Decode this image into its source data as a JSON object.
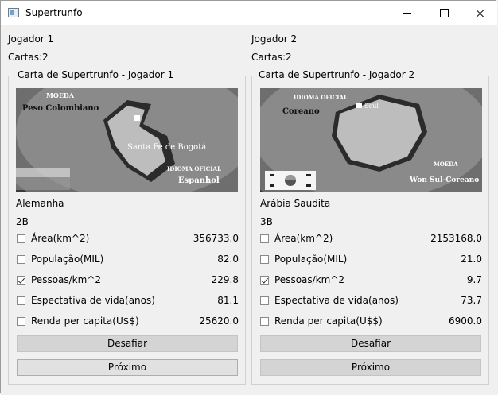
{
  "window": {
    "title": "Supertrunfo"
  },
  "players": [
    {
      "name": "Jogador 1",
      "cards_label": "Cartas:2",
      "group_title": "Carta de Supertrunfo - Jogador 1",
      "card": {
        "image_text": {
          "moeda": "MOEDA",
          "moeda_value": "Peso Colombiano",
          "capital": "Santa Fe de Bogotá",
          "idioma": "IDIOMA OFICIAL",
          "idioma_value": "Espanhol"
        },
        "country": "Alemanha",
        "code": "2B",
        "attributes": [
          {
            "label": "Área(km^2)",
            "value": "356733.0",
            "checked": false
          },
          {
            "label": "População(MIL)",
            "value": "82.0",
            "checked": false
          },
          {
            "label": "Pessoas/km^2",
            "value": "229.8",
            "checked": true
          },
          {
            "label": "Espectativa de vida(anos)",
            "value": "81.1",
            "checked": false
          },
          {
            "label": "Renda per capita(U$$)",
            "value": "25620.0",
            "checked": false
          }
        ]
      },
      "challenge_label": "Desafiar",
      "next_label": "Próximo"
    },
    {
      "name": "Jogador 2",
      "cards_label": "Cartas:2",
      "group_title": "Carta de Supertrunfo - Jogador 2",
      "card": {
        "image_text": {
          "idioma": "IDIOMA OFICIAL",
          "idioma_value": "Coreano",
          "capital": "Seul",
          "moeda": "MOEDA",
          "moeda_value": "Won Sul-Coreano"
        },
        "country": "Arábia Saudita",
        "code": "3B",
        "attributes": [
          {
            "label": "Área(km^2)",
            "value": "2153168.0",
            "checked": false
          },
          {
            "label": "População(MIL)",
            "value": "21.0",
            "checked": false
          },
          {
            "label": "Pessoas/km^2",
            "value": "9.7",
            "checked": true
          },
          {
            "label": "Espectativa de vida(anos)",
            "value": "73.7",
            "checked": false
          },
          {
            "label": "Renda per capita(U$$)",
            "value": "6900.0",
            "checked": false
          }
        ]
      },
      "challenge_label": "Desafiar",
      "next_label": "Próximo"
    }
  ]
}
